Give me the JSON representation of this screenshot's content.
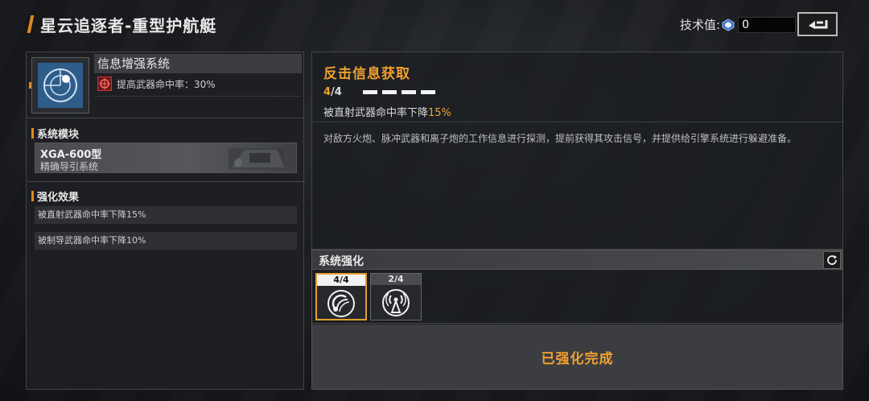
{
  "header": {
    "title": "星云追逐者-重型护航艇",
    "tech_label": "技术值:",
    "tech_value": "0",
    "back_icon": "back-arrow-icon"
  },
  "system": {
    "name": "信息增强系统",
    "effect": "提高武器命中率：30%",
    "icon": "radar-scope-icon",
    "effect_icon": "crosshair-icon"
  },
  "module": {
    "section_label": "系统模块",
    "model": "XGA-600型",
    "desc": "精确导引系统"
  },
  "effects": {
    "section_label": "强化效果",
    "items": [
      "被直射武器命中率下降15%",
      "被制导武器命中率下降10%"
    ]
  },
  "ability": {
    "title": "反击信息获取",
    "level_current": "4",
    "level_total": "/4",
    "level_fraction": 1.0,
    "pips_filled": 4,
    "pips_total": 4,
    "effect_prefix": "被直射武器命中率下降",
    "effect_value": "15%",
    "description": "对敌方火炮、脉冲武器和离子炮的工作信息进行探测，提前获得其攻击信号，并提供给引擎系统进行躲避准备。"
  },
  "enhance": {
    "title": "系统强化",
    "refresh_icon": "refresh-icon",
    "slots": [
      {
        "label": "4/4",
        "icon": "signal-deflect-icon",
        "active": true
      },
      {
        "label": "2/4",
        "icon": "broadcast-tower-icon",
        "active": false
      }
    ],
    "status": "已强化完成"
  },
  "colors": {
    "accent": "#f0a030",
    "accent_marker": "#e08a1e",
    "panel_bg": "#1c1e22",
    "icon_blue": "#2f5d8a"
  }
}
